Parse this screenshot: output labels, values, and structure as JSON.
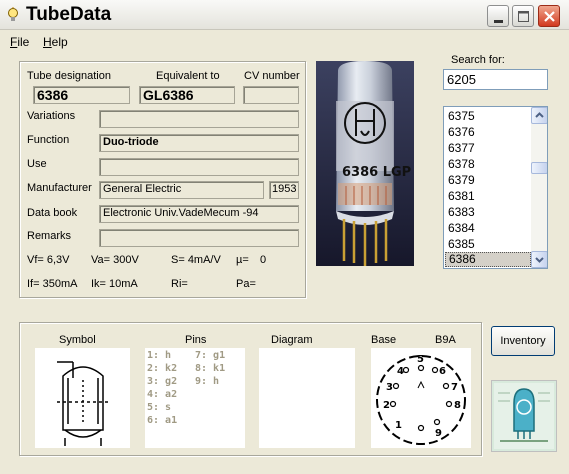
{
  "window": {
    "title": "TubeData"
  },
  "menu": [
    {
      "label": "File",
      "accel": "F",
      "rest": "ile"
    },
    {
      "label": "Help",
      "accel": "H",
      "rest": "elp"
    }
  ],
  "details": {
    "tube_designation_label": "Tube designation",
    "tube_designation": "6386",
    "equivalent_label": "Equivalent to",
    "equivalent": "GL6386",
    "cv_label": "CV number",
    "cv": "",
    "variations_label": "Variations",
    "variations": "",
    "function_label": "Function",
    "function": "Duo-triode",
    "use_label": "Use",
    "use": "",
    "manufacturer_label": "Manufacturer",
    "manufacturer": "General Electric",
    "year": "1953",
    "databook_label": "Data book",
    "databook": "Electronic Univ.VadeMecum -94",
    "remarks_label": "Remarks",
    "remarks": "",
    "params": {
      "vf": "Vf= 6,3V",
      "va": "Va= 300V",
      "s": "S= 4mA/V",
      "mu": "µ=",
      "mu_val": "0",
      "if": "If= 350mA",
      "ik": "Ik= 10mA",
      "ri": "Ri=",
      "pa": "Pa="
    }
  },
  "photo": {
    "marking": "6386 LGP"
  },
  "search": {
    "label": "Search for:",
    "value": "6205",
    "list": [
      "6375",
      "6376",
      "6377",
      "6378",
      "6379",
      "6381",
      "6383",
      "6384",
      "6385",
      "6386"
    ],
    "selected": "6386"
  },
  "lower": {
    "symbol_label": "Symbol",
    "pins_label": "Pins",
    "diagram_label": "Diagram",
    "base_label": "Base",
    "base_type": "B9A",
    "pins_col1": [
      "1: h",
      "2: k2",
      "3: g2",
      "4: a2",
      "5: s",
      "6: a1"
    ],
    "pins_col2": [
      "7: g1",
      "8: k1",
      "9: h"
    ],
    "base_numbers": [
      "1",
      "2",
      "3",
      "4",
      "5",
      "6",
      "7",
      "8",
      "9"
    ]
  },
  "inventory_label": "Inventory",
  "colors": {
    "selection": "#d4d0c8",
    "border_blue": "#7f9db9",
    "window_bg": "#ece9d8"
  }
}
